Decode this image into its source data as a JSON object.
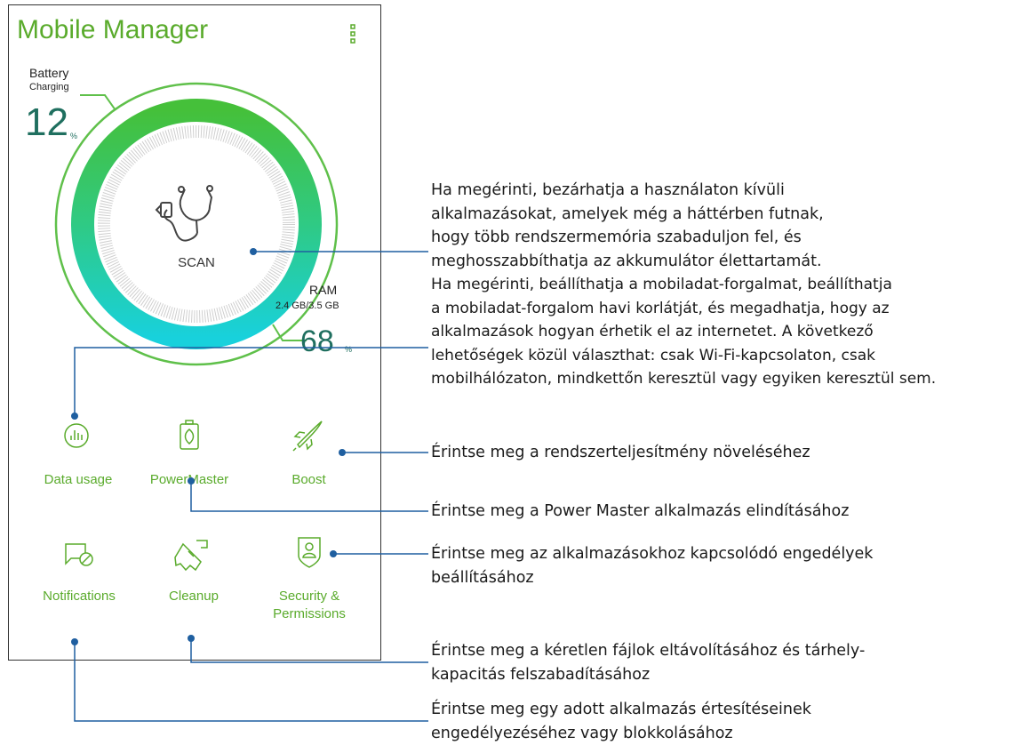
{
  "app": {
    "title": "Mobile Manager"
  },
  "battery": {
    "label": "Battery",
    "status": "Charging",
    "value": "12",
    "unit": "%"
  },
  "ram": {
    "label": "RAM",
    "usage": "2.4 GB/3.5 GB",
    "value": "68",
    "unit": "%"
  },
  "scan": {
    "label": "SCAN"
  },
  "tiles": [
    {
      "label": "Data usage",
      "icon": "data-usage-icon"
    },
    {
      "label": "PowerMaster",
      "icon": "battery-leaf-icon"
    },
    {
      "label": "Boost",
      "icon": "rocket-icon"
    },
    {
      "label": "Notifications",
      "icon": "notification-block-icon"
    },
    {
      "label": "Cleanup",
      "icon": "broom-icon"
    },
    {
      "label_line1": "Security &",
      "label_line2": "Permissions",
      "icon": "shield-user-icon"
    }
  ],
  "annotations": {
    "scan_lines": [
      "Ha megérinti, bezárhatja a használaton kívüli",
      "alkalmazásokat, amelyek még a háttérben futnak,",
      "hogy több rendszermemória szabaduljon fel, és",
      "meghosszabbíthatja az akkumulátor élettartamát."
    ],
    "data_lines": [
      "Ha megérinti, beállíthatja a mobiladat-forgalmat, beállíthatja",
      "a mobiladat-forgalom havi korlátját, és megadhatja, hogy az",
      "alkalmazások hogyan érhetik el az internetet. A következő",
      "lehetőségek közül választhat: csak Wi-Fi-kapcsolaton, csak",
      "mobilhálózaton, mindkettőn keresztül vagy egyiken keresztül sem."
    ],
    "boost": "Érintse meg a rendszerteljesítmény növeléséhez",
    "powermaster": "Érintse meg a Power Master alkalmazás elindításához",
    "security_lines": [
      "Érintse meg az alkalmazásokhoz kapcsolódó engedélyek",
      "beállításához"
    ],
    "cleanup_lines": [
      "Érintse meg a kéretlen fájlok eltávolításához és tárhely-",
      "kapacitás felszabadításához"
    ],
    "notifications_lines": [
      "Érintse meg egy adott alkalmazás értesítéseinek",
      "engedélyezéséhez vagy blokkolásához"
    ]
  },
  "colors": {
    "brand_green": "#5aab2c",
    "gauge_top": "#3fbf3a",
    "gauge_bottom": "#1ccfd8",
    "callout_line": "#1f5fa0"
  }
}
